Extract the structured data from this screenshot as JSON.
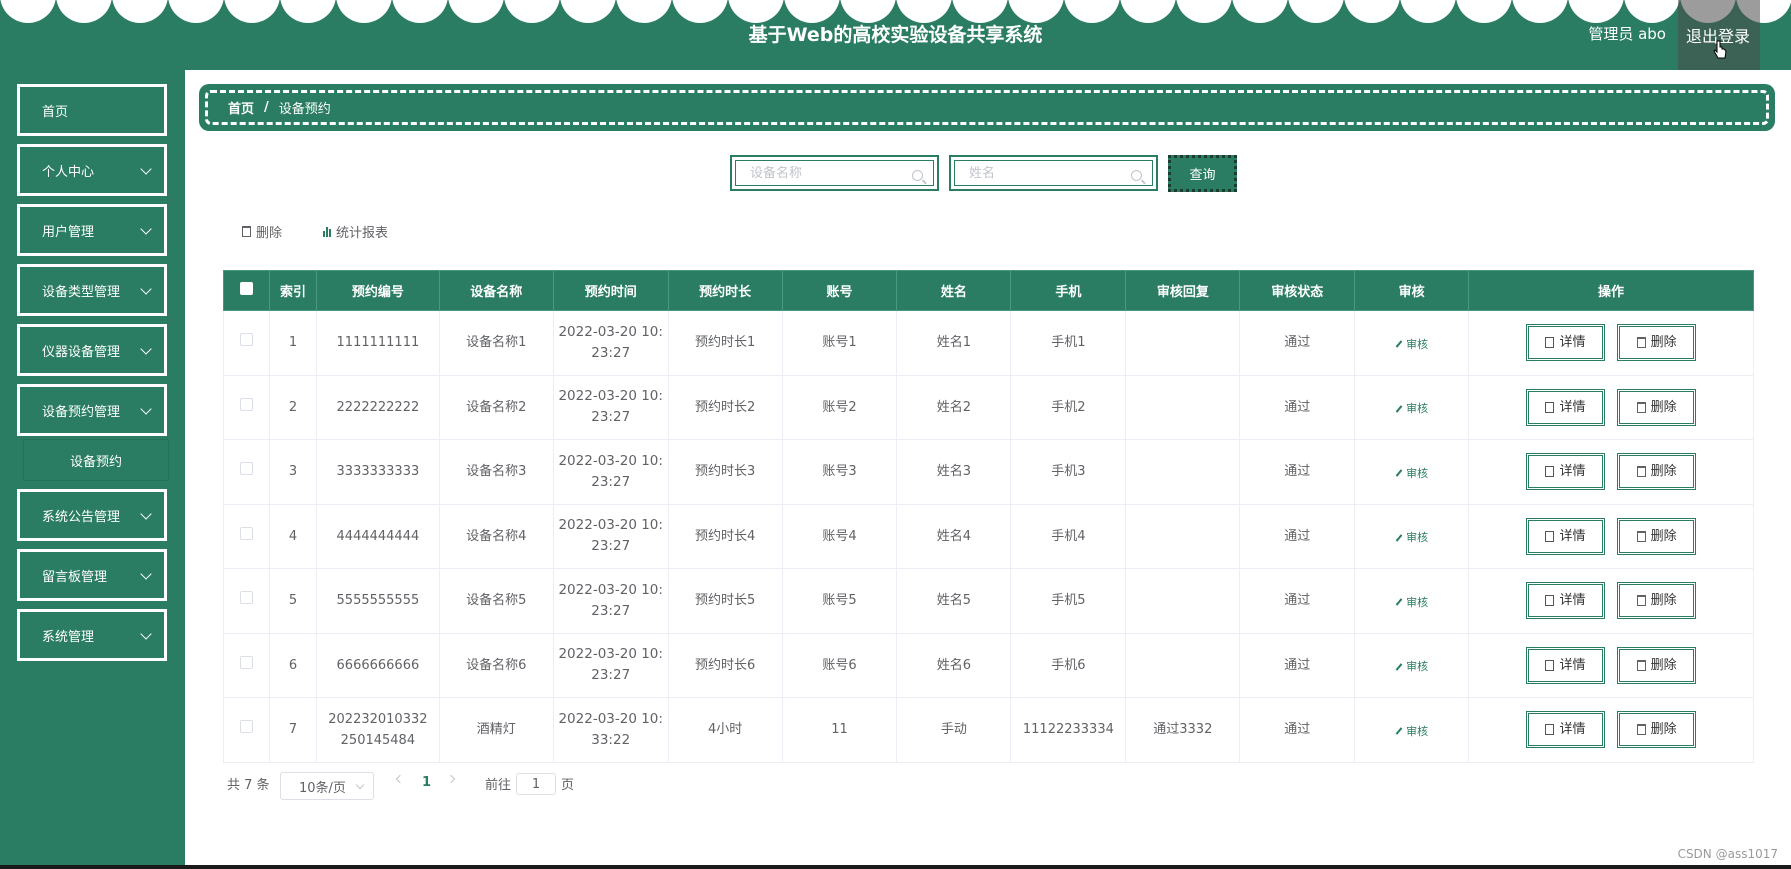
{
  "header": {
    "title": "基于Web的高校实验设备共享系统",
    "user": "管理员 abo",
    "logout": "退出登录"
  },
  "sidebar": {
    "items": [
      {
        "label": "首页",
        "has_children": false
      },
      {
        "label": "个人中心",
        "has_children": true
      },
      {
        "label": "用户管理",
        "has_children": true
      },
      {
        "label": "设备类型管理",
        "has_children": true
      },
      {
        "label": "仪器设备管理",
        "has_children": true
      },
      {
        "label": "设备预约管理",
        "has_children": true
      },
      {
        "label": "系统公告管理",
        "has_children": true
      },
      {
        "label": "留言板管理",
        "has_children": true
      },
      {
        "label": "系统管理",
        "has_children": true
      }
    ],
    "submenu": {
      "label": "设备预约"
    }
  },
  "breadcrumb": {
    "home": "首页",
    "separator": "/",
    "current": "设备预约"
  },
  "search": {
    "device_placeholder": "设备名称",
    "name_placeholder": "姓名",
    "query_label": "查询"
  },
  "toolbar": {
    "delete_label": "删除",
    "report_label": "统计报表"
  },
  "table": {
    "headers": [
      "索引",
      "预约编号",
      "设备名称",
      "预约时间",
      "预约时长",
      "账号",
      "姓名",
      "手机",
      "审核回复",
      "审核状态",
      "审核",
      "操作"
    ],
    "audit_label": "审核",
    "detail_label": "详情",
    "delete_label": "删除",
    "rows": [
      {
        "index": "1",
        "code": "1111111111",
        "device": "设备名称1",
        "time1": "2022-03-20 10:",
        "time2": "23:27",
        "duration": "预约时长1",
        "account": "账号1",
        "name": "姓名1",
        "phone": "手机1",
        "reply": "",
        "status": "通过"
      },
      {
        "index": "2",
        "code": "2222222222",
        "device": "设备名称2",
        "time1": "2022-03-20 10:",
        "time2": "23:27",
        "duration": "预约时长2",
        "account": "账号2",
        "name": "姓名2",
        "phone": "手机2",
        "reply": "",
        "status": "通过"
      },
      {
        "index": "3",
        "code": "3333333333",
        "device": "设备名称3",
        "time1": "2022-03-20 10:",
        "time2": "23:27",
        "duration": "预约时长3",
        "account": "账号3",
        "name": "姓名3",
        "phone": "手机3",
        "reply": "",
        "status": "通过"
      },
      {
        "index": "4",
        "code": "4444444444",
        "device": "设备名称4",
        "time1": "2022-03-20 10:",
        "time2": "23:27",
        "duration": "预约时长4",
        "account": "账号4",
        "name": "姓名4",
        "phone": "手机4",
        "reply": "",
        "status": "通过"
      },
      {
        "index": "5",
        "code": "5555555555",
        "device": "设备名称5",
        "time1": "2022-03-20 10:",
        "time2": "23:27",
        "duration": "预约时长5",
        "account": "账号5",
        "name": "姓名5",
        "phone": "手机5",
        "reply": "",
        "status": "通过"
      },
      {
        "index": "6",
        "code": "6666666666",
        "device": "设备名称6",
        "time1": "2022-03-20 10:",
        "time2": "23:27",
        "duration": "预约时长6",
        "account": "账号6",
        "name": "姓名6",
        "phone": "手机6",
        "reply": "",
        "status": "通过"
      },
      {
        "index": "7",
        "code": "202232010332250145484",
        "device": "酒精灯",
        "time1": "2022-03-20 10:",
        "time2": "33:22",
        "duration": "4小时",
        "account": "11",
        "name": "手动",
        "phone": "11122233334",
        "reply": "通过3332",
        "status": "通过"
      }
    ]
  },
  "pagination": {
    "total": "共 7 条",
    "page_size": "10条/页",
    "current_page": "1",
    "goto_prefix": "前往",
    "goto_value": "1",
    "goto_suffix": "页"
  },
  "watermark": "CSDN @ass1017",
  "colors": {
    "primary": "#2a7d62",
    "header_text": "#ffffff"
  }
}
